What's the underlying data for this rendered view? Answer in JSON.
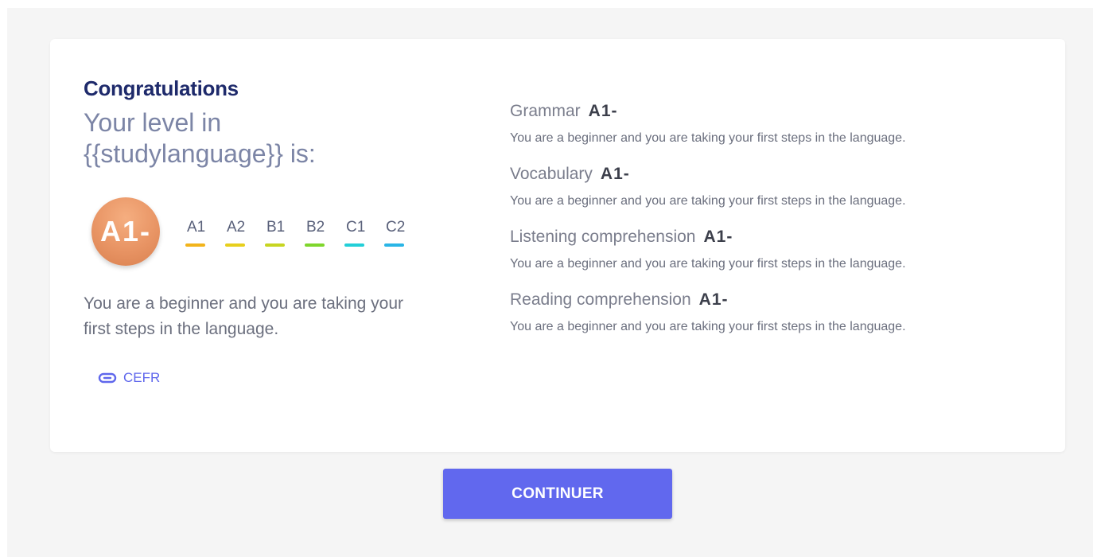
{
  "result": {
    "congrats": "Congratulations",
    "level_line1": "Your level in",
    "level_line2": "{{studylanguage}} is:",
    "level": "A1-",
    "description": "You are a beginner and you are taking your first steps in the language.",
    "cefr_link": "CEFR"
  },
  "scale": [
    {
      "label": "A1",
      "color": "#f2b41b"
    },
    {
      "label": "A2",
      "color": "#e7cf1d"
    },
    {
      "label": "B1",
      "color": "#c7d521"
    },
    {
      "label": "B2",
      "color": "#7fd62c"
    },
    {
      "label": "C1",
      "color": "#23cfd8"
    },
    {
      "label": "C2",
      "color": "#2ab5e6"
    }
  ],
  "skills": [
    {
      "name": "Grammar",
      "level": "A1-",
      "description": "You are a beginner and you are taking your first steps in the language."
    },
    {
      "name": "Vocabulary",
      "level": "A1-",
      "description": "You are a beginner and you are taking your first steps in the language."
    },
    {
      "name": "Listening comprehension",
      "level": "A1-",
      "description": "You are a beginner and you are taking your first steps in the language."
    },
    {
      "name": "Reading comprehension",
      "level": "A1-",
      "description": "You are a beginner and you are taking your first steps in the language."
    }
  ],
  "continue_label": "CONTINUER",
  "icons": {
    "cefr": "link-icon"
  },
  "colors": {
    "accent": "#6168ee",
    "heading": "#1e2a6b",
    "badge": "#e89464"
  }
}
